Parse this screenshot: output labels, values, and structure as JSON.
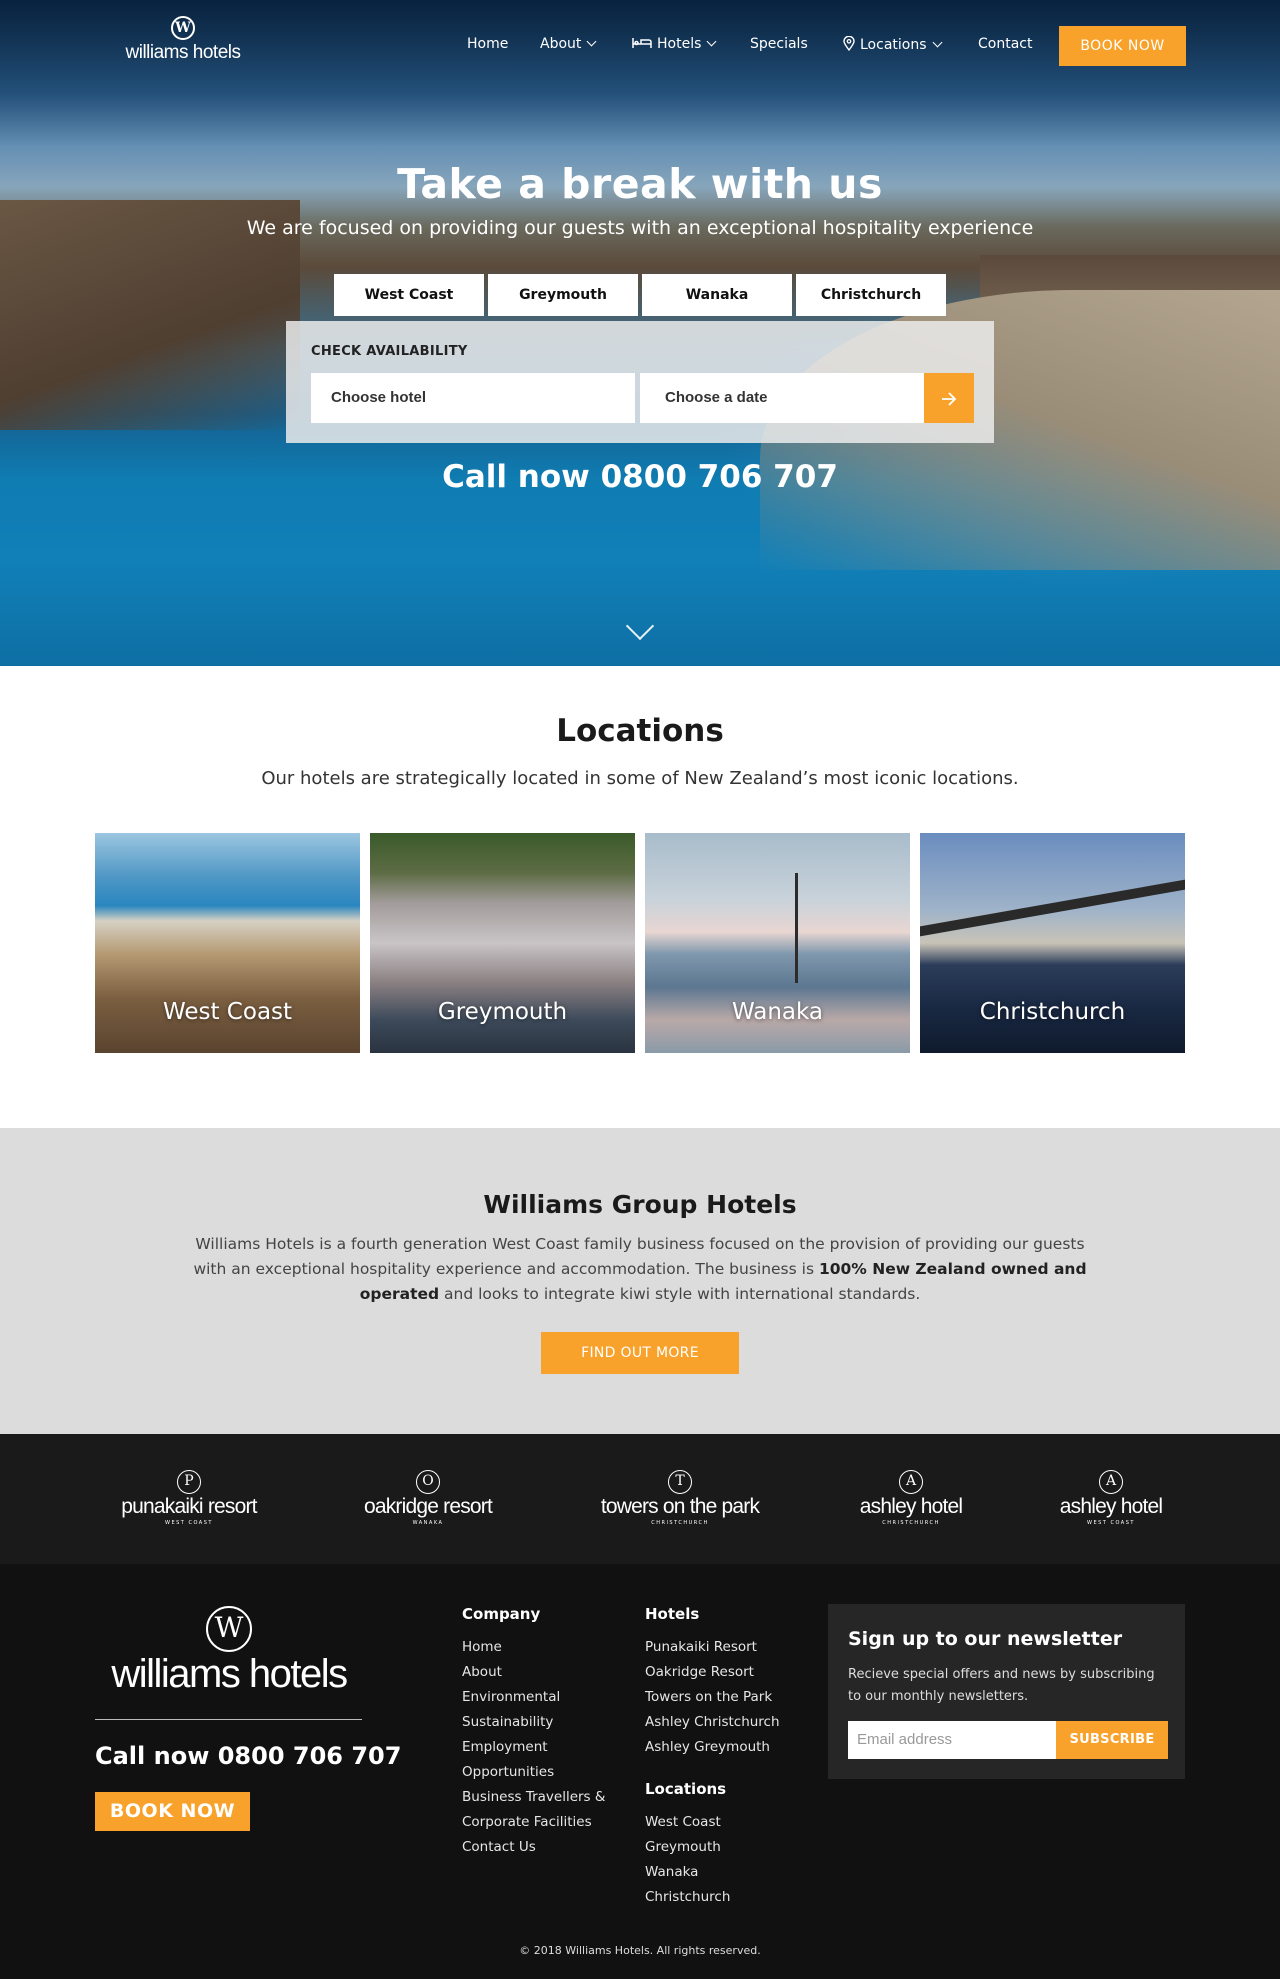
{
  "brand": {
    "mark": "W",
    "name": "williams hotels"
  },
  "nav": {
    "items": [
      {
        "label": "Home"
      },
      {
        "label": "About"
      },
      {
        "label": "Hotels"
      },
      {
        "label": "Specials"
      },
      {
        "label": "Locations"
      },
      {
        "label": "Contact"
      }
    ],
    "book_now": "BOOK NOW"
  },
  "hero": {
    "title": "Take a break with us",
    "subtitle": "We are focused on providing our guests with an exceptional hospitality experience",
    "tabs": [
      "West Coast",
      "Greymouth",
      "Wanaka",
      "Christchurch"
    ],
    "availability_label": "CHECK AVAILABILITY",
    "hotel_placeholder": "Choose hotel",
    "date_placeholder": "Choose a date",
    "call": "Call now 0800 706 707"
  },
  "locations": {
    "title": "Locations",
    "subtitle": "Our hotels are strategically located in some of New Zealand’s most iconic locations.",
    "cards": [
      {
        "label": "West Coast"
      },
      {
        "label": "Greymouth"
      },
      {
        "label": "Wanaka"
      },
      {
        "label": "Christchurch"
      }
    ]
  },
  "group": {
    "title": "Williams Group Hotels",
    "text_part1": "Williams Hotels is a fourth generation West Coast family business focused on the provision of providing our guests with an exceptional hospitality experience and accommodation. The business is ",
    "text_bold": "100% New Zealand owned and operated",
    "text_part2": " and looks to integrate kiwi style with international standards.",
    "button": "FIND OUT MORE"
  },
  "brands": [
    {
      "mark": "P",
      "name": "punakaiki resort",
      "place": "WEST COAST"
    },
    {
      "mark": "O",
      "name": "oakridge resort",
      "place": "WANAKA"
    },
    {
      "mark": "T",
      "name": "towers on the park",
      "place": "CHRISTCHURCH"
    },
    {
      "mark": "A",
      "name": "ashley hotel",
      "place": "CHRISTCHURCH"
    },
    {
      "mark": "A",
      "name": "ashley hotel",
      "place": "WEST COAST"
    }
  ],
  "footer": {
    "logo_mark": "W",
    "logo_name": "williams hotels",
    "call": "Call now 0800 706 707",
    "book_now": "BOOK NOW",
    "company": {
      "title": "Company",
      "links": [
        "Home",
        "About",
        "Environmental",
        "Sustainability",
        "Employment",
        "Opportunities",
        "Business Travellers &",
        "Corporate Facilities",
        "Contact Us"
      ]
    },
    "hotels": {
      "title": "Hotels",
      "links": [
        "Punakaiki Resort",
        "Oakridge Resort",
        "Towers on the Park",
        "Ashley Christchurch",
        "Ashley Greymouth"
      ]
    },
    "locations": {
      "title": "Locations",
      "links": [
        "West Coast",
        "Greymouth",
        "Wanaka",
        "Christchurch"
      ]
    },
    "newsletter": {
      "title": "Sign up to our newsletter",
      "text": "Recieve special offers and news by subscribing to our monthly newsletters.",
      "placeholder": "Email address",
      "button": "SUBSCRIBE"
    },
    "copyright": "© 2018 Williams Hotels. All rights reserved."
  },
  "colors": {
    "accent": "#f9a22b",
    "footer_bg": "#111111",
    "brands_bg": "#1a1a1a",
    "group_bg": "#dcdcdc"
  },
  "icons": {
    "hotels": "bed-icon",
    "locations": "map-pin-icon",
    "go": "arrow-right-icon",
    "scroll": "chevron-down-icon"
  }
}
